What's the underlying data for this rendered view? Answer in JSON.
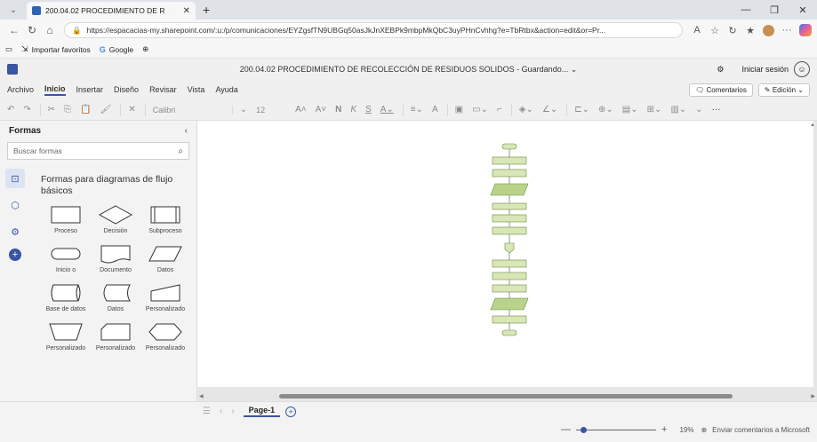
{
  "browser": {
    "tab_title": "200.04.02 PROCEDIMIENTO DE R",
    "url": "https://espacacias-my.sharepoint.com/:u:/p/comunicaciones/EYZgsfTN9UBGq50asJkJnXEBPk9mbpMkQbC3uyPHnCvhhg?e=TbRtbx&action=edit&or=Pr...",
    "favorites": [
      {
        "label": "Importar favoritos",
        "icon": "import-icon"
      },
      {
        "label": "Google",
        "icon": "google-icon"
      }
    ]
  },
  "app": {
    "doc_title": "200.04.02 PROCEDIMIENTO DE RECOLECCIÓN DE RESIDUOS SOLIDOS - Guardando... ⌄",
    "signin_label": "Iniciar sesión",
    "ribbon_tabs": [
      "Archivo",
      "Inicio",
      "Insertar",
      "Diseño",
      "Revisar",
      "Vista",
      "Ayuda"
    ],
    "active_tab": "Inicio",
    "comments_label": "Comentarios",
    "edit_label": "Edición ⌄",
    "font_name": "Calibri",
    "font_size": "12"
  },
  "sidebar": {
    "title": "Formas",
    "search_placeholder": "Buscar formas",
    "stencil_title": "Formas para diagramas de flujo básicos",
    "shapes": [
      "Proceso",
      "Decisión",
      "Subproceso",
      "Inicio o",
      "Documento",
      "Datos",
      "Base de datos",
      "Datos",
      "Personalizado",
      "Personalizado",
      "Personalizado",
      "Personalizado"
    ]
  },
  "page_tabs": {
    "current": "Page-1"
  },
  "status": {
    "zoom": "19%",
    "feedback": "Enviar comentarios a Microsoft"
  }
}
